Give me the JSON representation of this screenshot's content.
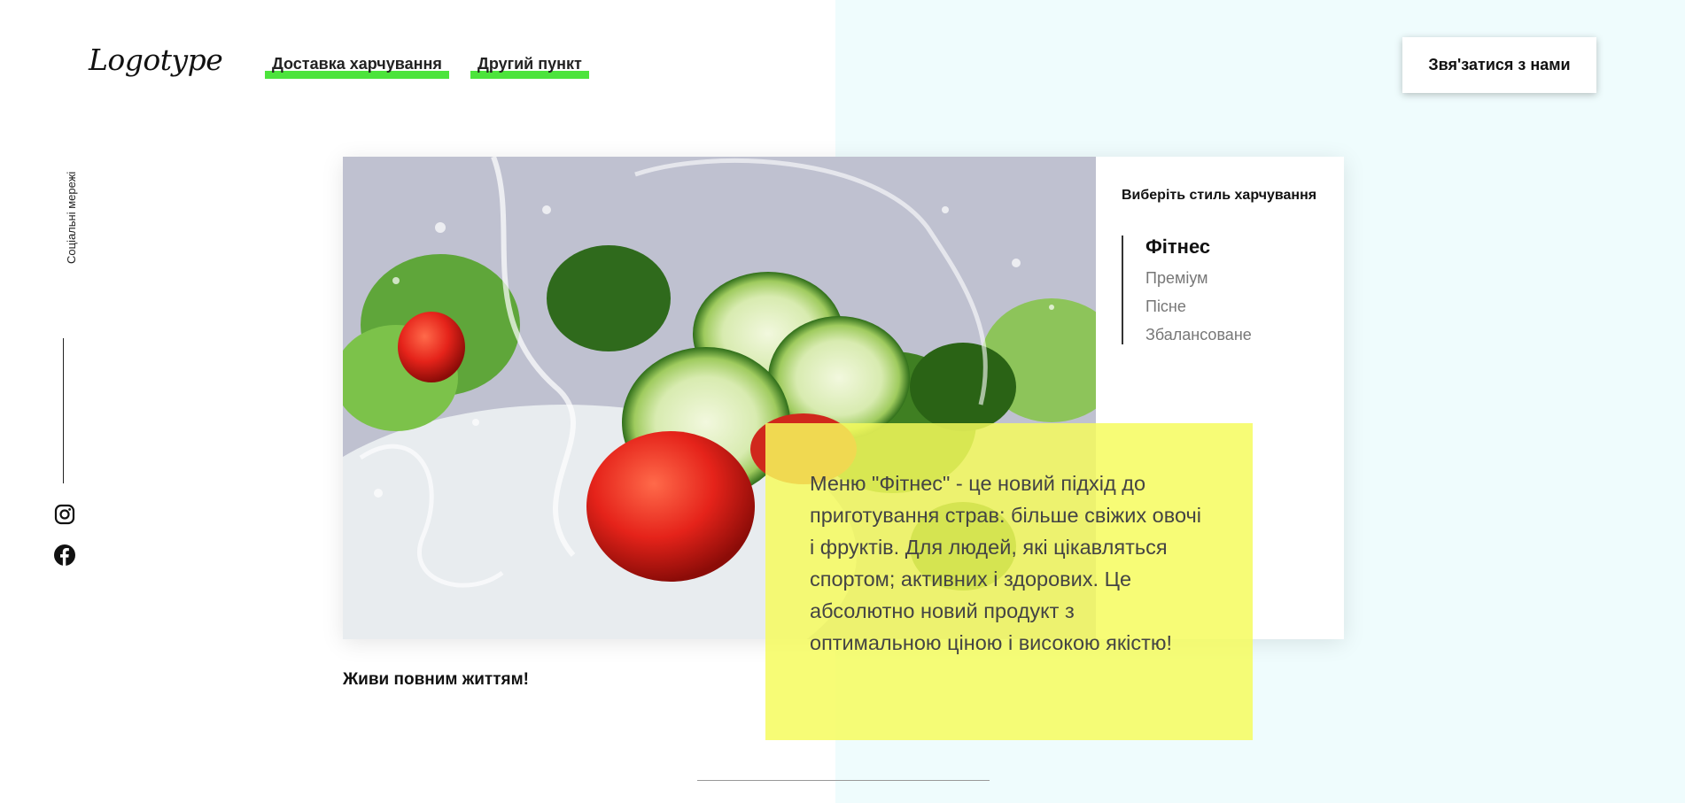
{
  "header": {
    "logo": "Logotype",
    "nav": [
      {
        "label": "Доставка харчування"
      },
      {
        "label": "Другий пункт"
      }
    ],
    "contact_button": "Звя'затися з нами",
    "accent_color": "#4ce43c"
  },
  "sidebar": {
    "social_label": "Соціальні мережі",
    "icons": [
      "instagram-icon",
      "facebook-icon"
    ]
  },
  "panel": {
    "title": "Виберіть стиль харчування",
    "styles": [
      {
        "label": "Фітнес",
        "active": true
      },
      {
        "label": "Преміум",
        "active": false
      },
      {
        "label": "Пісне",
        "active": false
      },
      {
        "label": "Збалансоване",
        "active": false
      }
    ]
  },
  "description": {
    "text": "Меню \"Фітнес\" - це новий підхід до приготування страв: більше свіжих овочі і фруктів. Для людей, які цікавляться спортом; активних і здорових. Це абсолютно новий продукт з оптимальною ціною і високою якістю!",
    "background": "#f5fc5c"
  },
  "tagline": "Живи повним життям!"
}
